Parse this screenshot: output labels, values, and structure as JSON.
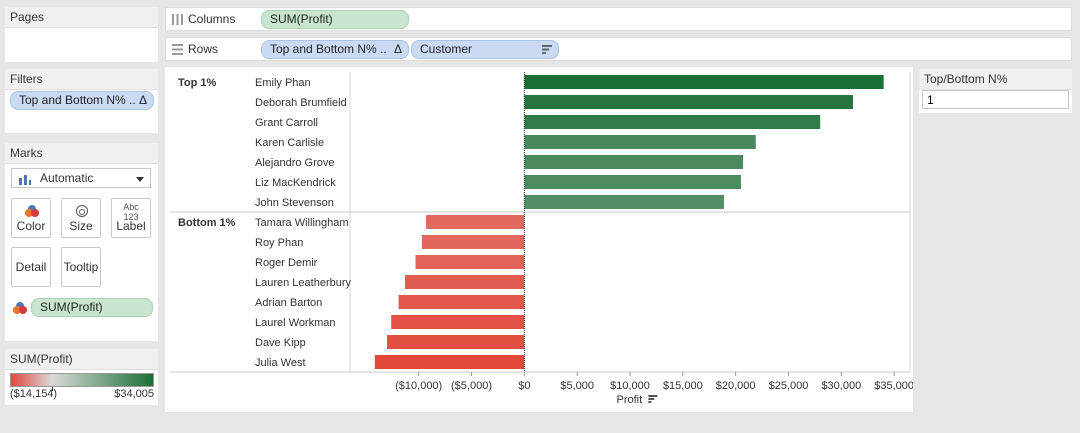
{
  "pages_card": {
    "title": "Pages"
  },
  "filters_card": {
    "title": "Filters",
    "pill_label": "Top and Bottom N% ..",
    "pill_icon": "Δ"
  },
  "marks_card": {
    "title": "Marks",
    "mark_type": "Automatic",
    "buttons": {
      "color": "Color",
      "size": "Size",
      "label": "Label",
      "label_icon_text": "Abc\n123",
      "detail": "Detail",
      "tooltip": "Tooltip"
    },
    "color_pill": "SUM(Profit)"
  },
  "legend_card": {
    "title": "SUM(Profit)",
    "min_label": "($14,154)",
    "max_label": "$34,005",
    "low_color": "#e3483b",
    "mid_color": "#d9d9d9",
    "high_color": "#1b6f36"
  },
  "columns_shelf": {
    "label": "Columns",
    "pills": [
      "SUM(Profit)"
    ]
  },
  "rows_shelf": {
    "label": "Rows",
    "pills": [
      "Top and Bottom N% ..",
      "Customer"
    ],
    "pill_icon": "Δ"
  },
  "parameter_card": {
    "title": "Top/Bottom N%",
    "value": "1"
  },
  "chart_data": {
    "type": "bar",
    "orientation": "horizontal",
    "xlabel": "Profit",
    "xlim": [
      -16500,
      36500
    ],
    "x_ticks": [
      -10000,
      -5000,
      0,
      5000,
      10000,
      15000,
      20000,
      25000,
      30000,
      35000
    ],
    "x_tick_labels": [
      "($10,000)",
      "($5,000)",
      "$0",
      "$5,000",
      "$10,000",
      "$15,000",
      "$20,000",
      "$25,000",
      "$30,000",
      "$35,000"
    ],
    "color_range": [
      -14154,
      34005
    ],
    "groups": [
      {
        "name": "Top 1%",
        "categories": [
          "Emily Phan",
          "Deborah Brumfield",
          "Grant Carroll",
          "Karen Carlisle",
          "Alejandro Grove",
          "Liz MacKendrick",
          "John Stevenson"
        ],
        "values": [
          34005,
          31100,
          28000,
          21900,
          20700,
          20500,
          18900
        ]
      },
      {
        "name": "Bottom 1%",
        "categories": [
          "Tamara Willingham",
          "Roy Phan",
          "Roger Demir",
          "Lauren Leatherbury",
          "Adrian Barton",
          "Laurel Workman",
          "Dave Kipp",
          "Julia West"
        ],
        "values": [
          -9300,
          -9700,
          -10300,
          -11300,
          -11900,
          -12600,
          -13000,
          -14154
        ]
      }
    ]
  }
}
